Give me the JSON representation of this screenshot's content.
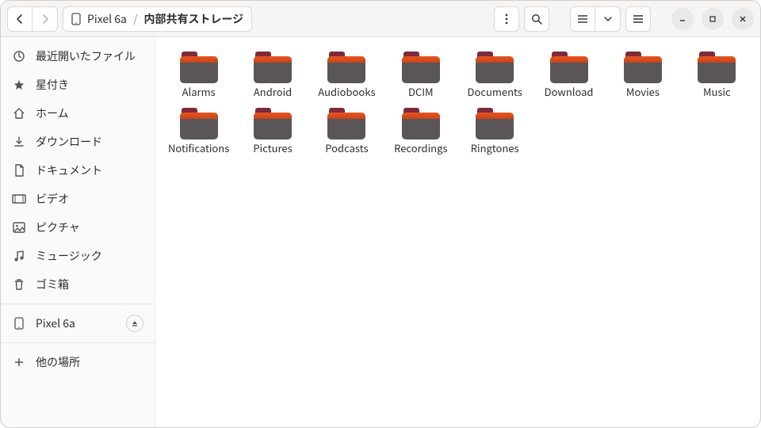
{
  "path": {
    "device": "Pixel 6a",
    "current": "内部共有ストレージ"
  },
  "sidebar": {
    "items": [
      {
        "label": "最近開いたファイル",
        "icon": "clock"
      },
      {
        "label": "星付き",
        "icon": "star"
      },
      {
        "label": "ホーム",
        "icon": "home"
      },
      {
        "label": "ダウンロード",
        "icon": "download"
      },
      {
        "label": "ドキュメント",
        "icon": "document"
      },
      {
        "label": "ビデオ",
        "icon": "video"
      },
      {
        "label": "ピクチャ",
        "icon": "picture"
      },
      {
        "label": "ミュージック",
        "icon": "music"
      },
      {
        "label": "ゴミ箱",
        "icon": "trash"
      }
    ],
    "device": {
      "label": "Pixel 6a"
    },
    "other": {
      "label": "他の場所"
    }
  },
  "folders": [
    {
      "name": "Alarms"
    },
    {
      "name": "Android"
    },
    {
      "name": "Audiobooks"
    },
    {
      "name": "DCIM"
    },
    {
      "name": "Documents"
    },
    {
      "name": "Download"
    },
    {
      "name": "Movies"
    },
    {
      "name": "Music"
    },
    {
      "name": "Notifications"
    },
    {
      "name": "Pictures"
    },
    {
      "name": "Podcasts"
    },
    {
      "name": "Recordings"
    },
    {
      "name": "Ringtones"
    }
  ]
}
